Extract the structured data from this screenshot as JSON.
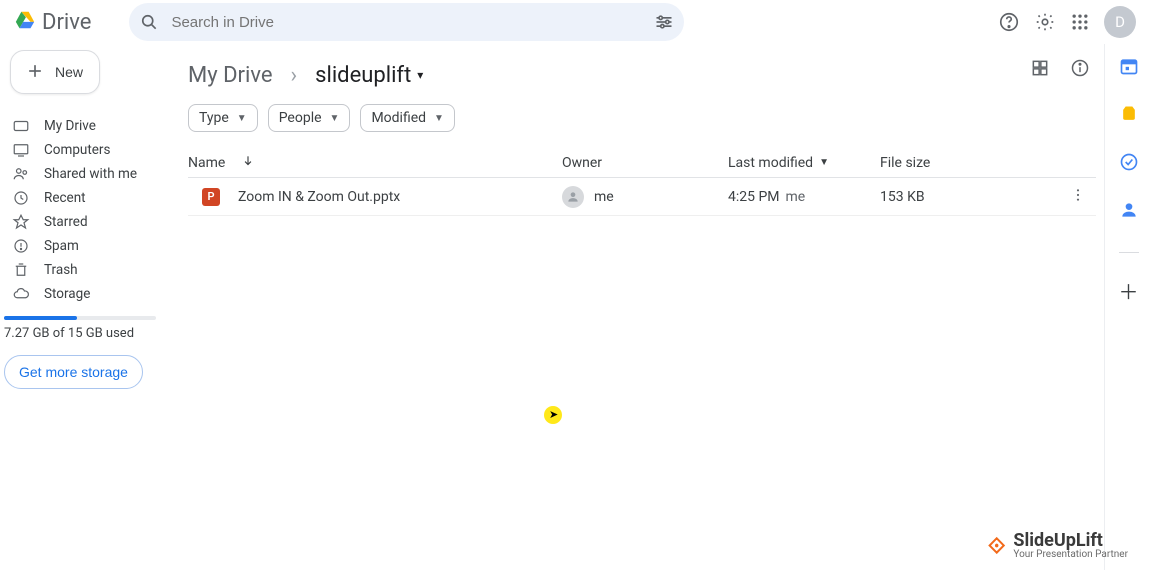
{
  "header": {
    "app_name": "Drive",
    "search_placeholder": "Search in Drive",
    "avatar_initial": "D"
  },
  "sidebar": {
    "new_label": "New",
    "items": [
      {
        "label": "My Drive"
      },
      {
        "label": "Computers"
      },
      {
        "label": "Shared with me"
      },
      {
        "label": "Recent"
      },
      {
        "label": "Starred"
      },
      {
        "label": "Spam"
      },
      {
        "label": "Trash"
      },
      {
        "label": "Storage"
      }
    ],
    "storage_text": "7.27 GB of 15 GB used",
    "get_storage_label": "Get more storage"
  },
  "breadcrumb": {
    "root": "My Drive",
    "leaf": "slideuplift"
  },
  "filters": {
    "type": "Type",
    "people": "People",
    "modified": "Modified"
  },
  "columns": {
    "name": "Name",
    "owner": "Owner",
    "last_modified": "Last modified",
    "file_size": "File size"
  },
  "rows": [
    {
      "name": "Zoom IN & Zoom Out.pptx",
      "owner": "me",
      "modified_time": "4:25 PM",
      "modified_by": "me",
      "size": "153 KB"
    }
  ],
  "watermark": {
    "brand": "SlideUpLift",
    "tagline": "Your Presentation Partner"
  }
}
